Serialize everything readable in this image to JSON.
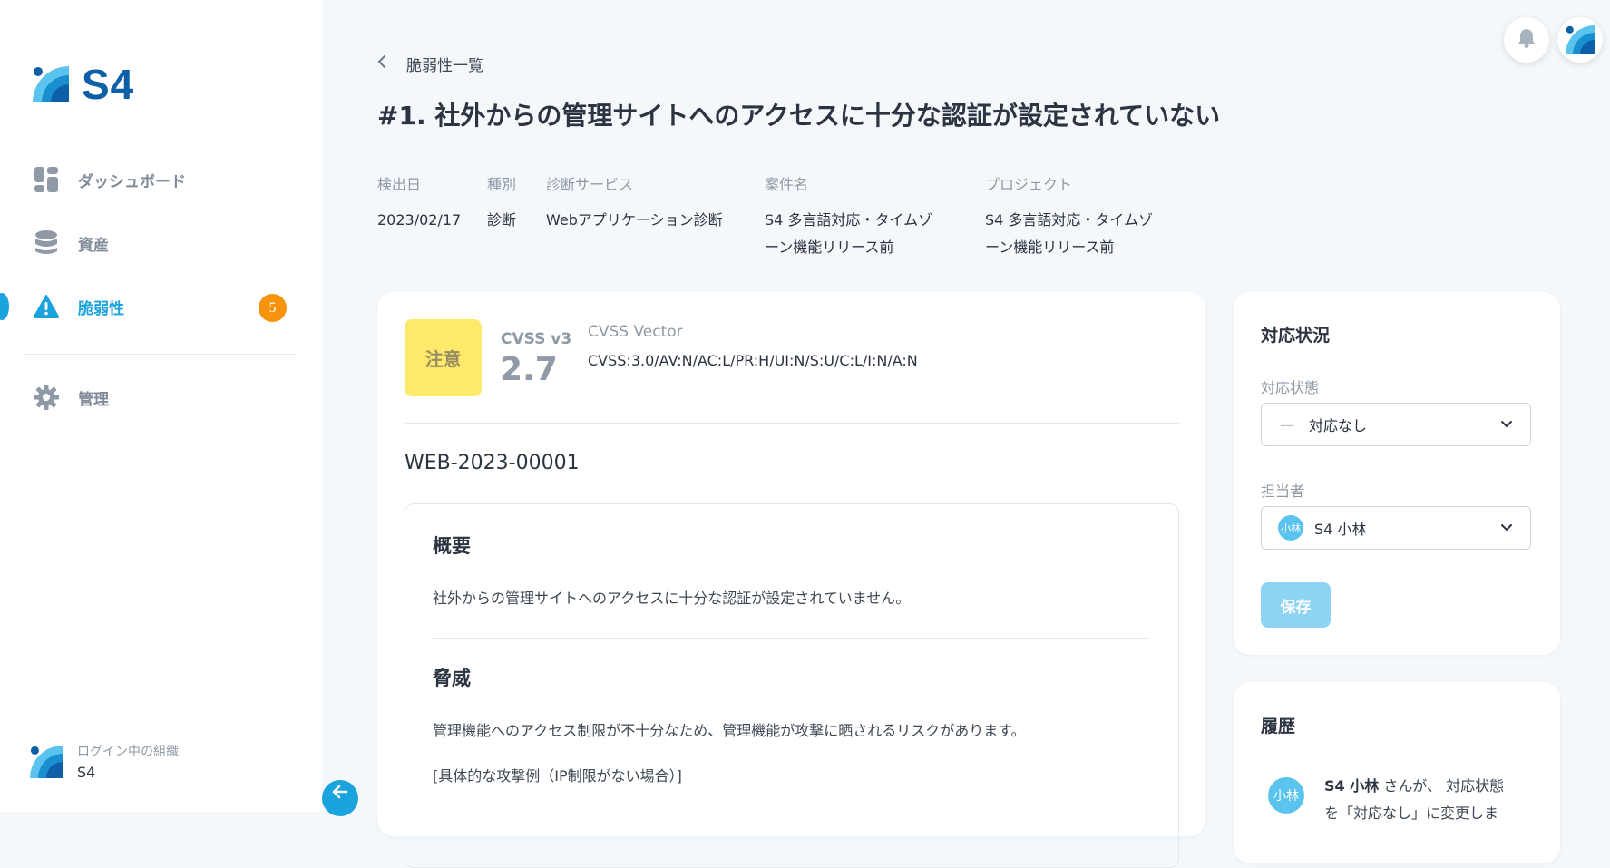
{
  "sidebar": {
    "logo_text": "S4",
    "items": [
      {
        "label": "ダッシュボード",
        "icon": "dashboard-icon"
      },
      {
        "label": "資産",
        "icon": "database-icon"
      },
      {
        "label": "脆弱性",
        "icon": "warning-icon",
        "badge": "5",
        "active": true
      },
      {
        "label": "管理",
        "icon": "gear-icon"
      }
    ],
    "org_label": "ログイン中の組織",
    "org_name": "S4"
  },
  "header": {
    "breadcrumb": "脆弱性一覧",
    "title": "#1. 社外からの管理サイトへのアクセスに十分な認証が設定されていない"
  },
  "meta": {
    "detected_label": "検出日",
    "detected_value": "2023/02/17",
    "type_label": "種別",
    "type_value": "診断",
    "service_label": "診断サービス",
    "service_value": "Webアプリケーション診断",
    "case_label": "案件名",
    "case_value_line1": "S4 多言語対応・タイムゾ",
    "case_value_line2": "ーン機能リリース前",
    "project_label": "プロジェクト",
    "project_value_line1": "S4 多言語対応・タイムゾ",
    "project_value_line2": "ーン機能リリース前"
  },
  "detail": {
    "severity": "注意",
    "cvss_label": "CVSS v3",
    "cvss_score": "2.7",
    "vector_label": "CVSS Vector",
    "vector_value": "CVSS:3.0/AV:N/AC:L/PR:H/UI:N/S:U/C:L/I:N/A:N",
    "vuln_id": "WEB-2023-00001",
    "summary_title": "概要",
    "summary_text": "社外からの管理サイトへのアクセスに十分な認証が設定されていません。",
    "threat_title": "脅威",
    "threat_text": "管理機能へのアクセス制限が不十分なため、管理機能が攻撃に晒されるリスクがあります。",
    "threat_example": "[具体的な攻撃例（IP制限がない場合）]"
  },
  "status": {
    "title": "対応状況",
    "state_label": "対応状態",
    "state_value": "対応なし",
    "assignee_label": "担当者",
    "assignee_avatar": "小林",
    "assignee_value": "S4 小林",
    "save_label": "保存"
  },
  "history": {
    "title": "履歴",
    "avatar": "小林",
    "user": "S4 小林",
    "text_line1": " さんが、 対応状態",
    "text_line2": "を「対応なし」に変更しま"
  },
  "colors": {
    "accent": "#1aa3dc",
    "brand": "#0d5fa8",
    "badge": "#f7930c",
    "severity_bg": "#fde96a"
  }
}
